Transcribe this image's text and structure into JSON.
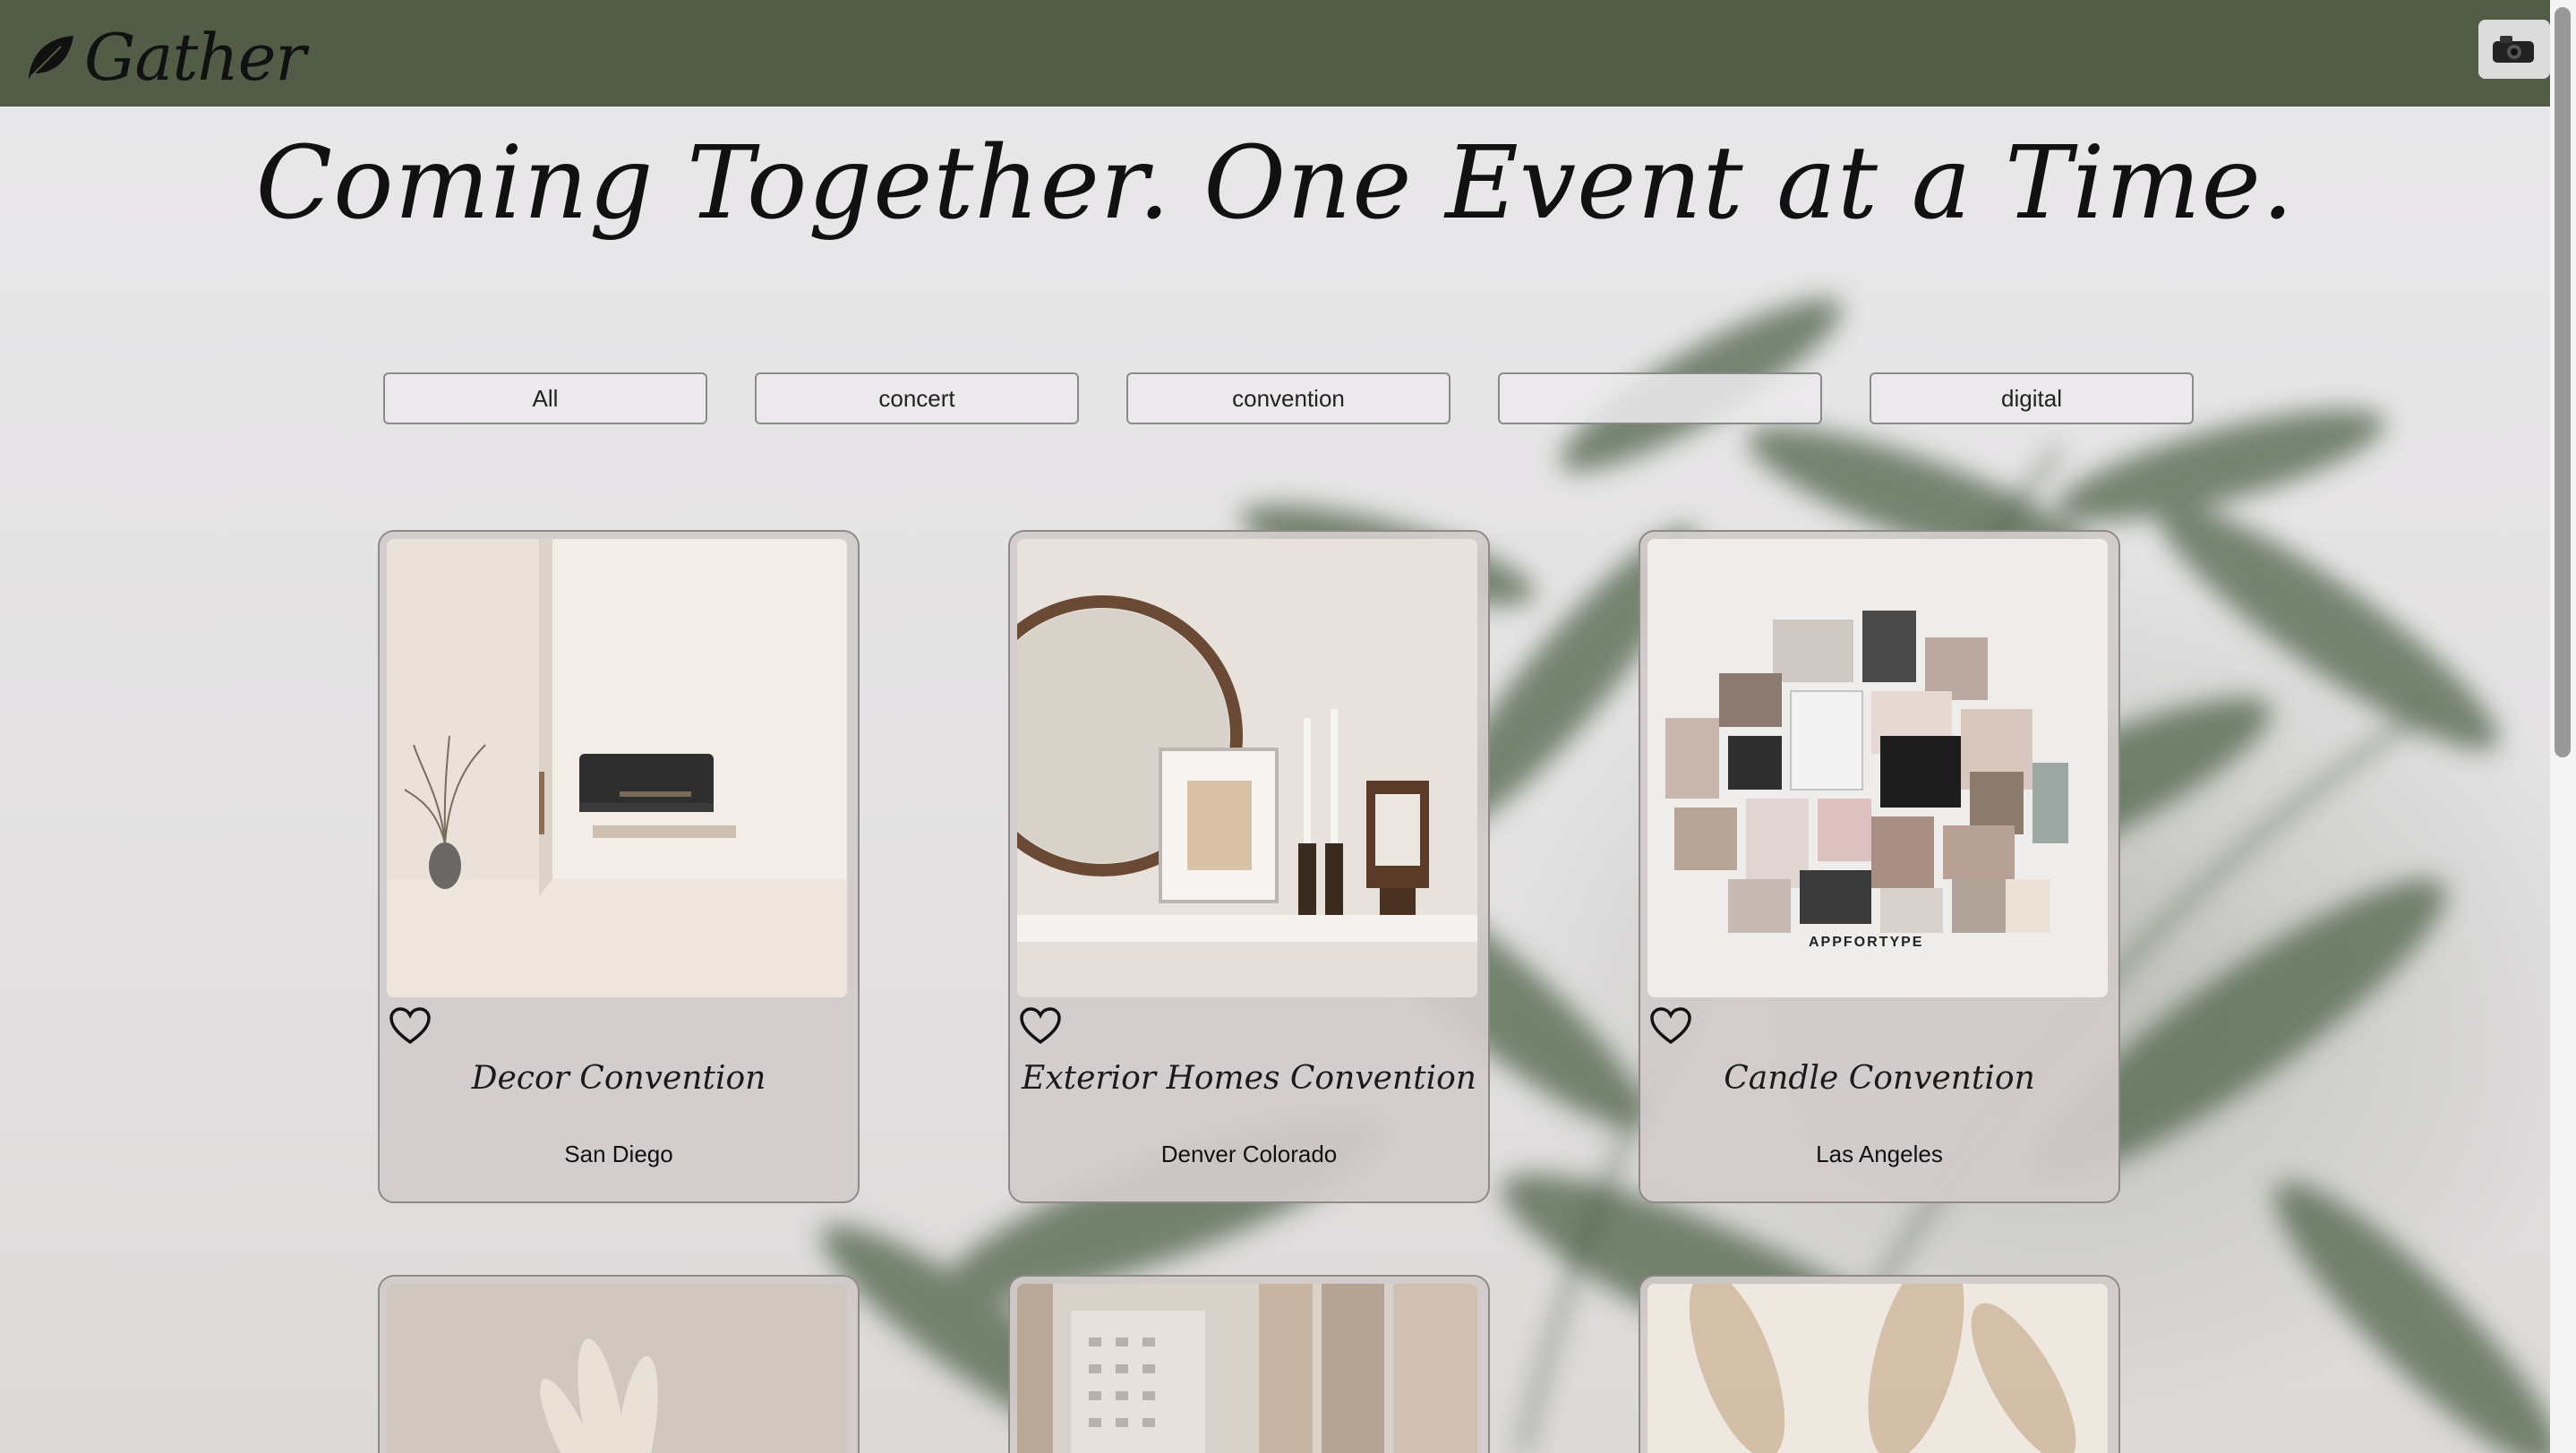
{
  "header": {
    "logo_text": "Gather",
    "avatar_icon": "camera-avatar-icon",
    "nav_color": "#525c46"
  },
  "hero": {
    "tagline": "Coming Together. One Event at a Time."
  },
  "filters": [
    {
      "label": "All"
    },
    {
      "label": "concert"
    },
    {
      "label": "convention"
    },
    {
      "label": ""
    },
    {
      "label": "digital"
    }
  ],
  "events": [
    {
      "title": "Decor Convention",
      "location": "San Diego",
      "image": "living-room-photo",
      "favorite_icon": "heart-outline-icon"
    },
    {
      "title": "Exterior Homes Convention",
      "location": "Denver Colorado",
      "image": "mirror-mantel-photo",
      "favorite_icon": "heart-outline-icon"
    },
    {
      "title": "Candle Convention",
      "location": "Las Angeles",
      "image": "moodboard-collage-photo",
      "favorite_icon": "heart-outline-icon"
    },
    {
      "title": "",
      "location": "",
      "image": "pampas-vase-photo"
    },
    {
      "title": "",
      "location": "",
      "image": "window-curtain-photo"
    },
    {
      "title": "",
      "location": "",
      "image": "pampas-grass-photo"
    }
  ]
}
